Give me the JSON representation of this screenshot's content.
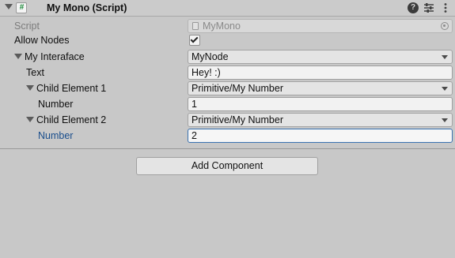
{
  "header": {
    "title": "My Mono (Script)",
    "script_glyph": "#",
    "help_glyph": "?",
    "icons": [
      "fold-arrow-icon",
      "script-icon",
      "help-icon",
      "preset-icon",
      "kebab-menu-icon"
    ]
  },
  "properties": {
    "script": {
      "label": "Script",
      "value": "MyMono"
    },
    "allow_nodes": {
      "label": "Allow Nodes",
      "checked": true
    },
    "my_interface": {
      "label": "My Interaface",
      "value": "MyNode"
    },
    "text": {
      "label": "Text",
      "value": "Hey! :)"
    },
    "child1": {
      "label": "Child Element 1",
      "value": "Primitive/My Number"
    },
    "child1_number": {
      "label": "Number",
      "value": "1"
    },
    "child2": {
      "label": "Child Element 2",
      "value": "Primitive/My Number"
    },
    "child2_number": {
      "label": "Number",
      "value": "2"
    }
  },
  "add_component_label": "Add Component",
  "colors": {
    "background": "#c8c8c8",
    "selected_label": "#1a4e8c",
    "focus_border": "#3a72b0"
  }
}
